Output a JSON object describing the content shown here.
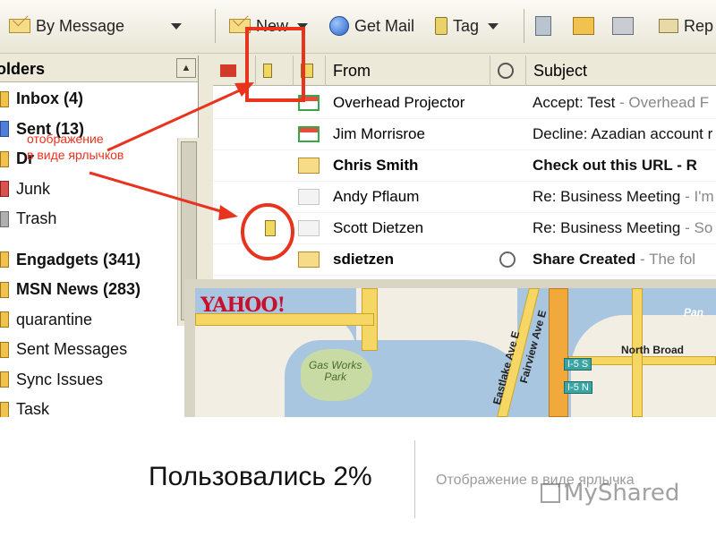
{
  "toolbar": {
    "view_label": "By Message",
    "new_label": "New",
    "get_mail_label": "Get Mail",
    "tag_label": "Tag",
    "reply_label": "Rep"
  },
  "folders": {
    "header": "olders",
    "items": [
      {
        "label": "Inbox (4)",
        "bold": true
      },
      {
        "label": "Sent (13)",
        "bold": true
      },
      {
        "label": "Dr",
        "bold": true
      },
      {
        "label": "Junk",
        "bold": false
      },
      {
        "label": "Trash",
        "bold": false
      },
      {
        "label": "Engadgets (341)",
        "bold": true
      },
      {
        "label": "MSN News (283)",
        "bold": true
      },
      {
        "label": "quarantine",
        "bold": false
      },
      {
        "label": "Sent Messages",
        "bold": false
      },
      {
        "label": "Sync Issues",
        "bold": false
      },
      {
        "label": "Task",
        "bold": false
      }
    ]
  },
  "message_list": {
    "columns": {
      "from": "From",
      "subject": "Subject"
    },
    "rows": [
      {
        "from": "Overhead Projector",
        "subject": "Accept: Test",
        "preview": " - Overhead F",
        "bold": false,
        "icon": "calendar-icon"
      },
      {
        "from": "Jim Morrisroe",
        "subject": "Decline: Azadian account r",
        "preview": "",
        "bold": false,
        "icon": "calendar-icon"
      },
      {
        "from": "Chris Smith",
        "subject": "Check out this URL - R",
        "preview": "",
        "bold": true,
        "icon": "envelope-icon"
      },
      {
        "from": "Andy Pflaum",
        "subject": "Re: Business Meeting",
        "preview": " - I'm",
        "bold": false,
        "icon": "open-envelope-icon"
      },
      {
        "from": "Scott Dietzen",
        "subject": "Re: Business Meeting",
        "preview": " - So",
        "bold": false,
        "icon": "open-envelope-icon"
      },
      {
        "from": "sdietzen",
        "subject": "Share Created",
        "preview": " - The fol",
        "bold": true,
        "icon": "envelope-icon"
      }
    ]
  },
  "map": {
    "logo": "YAHOO!",
    "park_line1": "Gas Works",
    "park_line2": "Park",
    "street_1": "Eastlake Ave E",
    "street_2": "Fairview Ave E",
    "north_broadway": "North Broad",
    "shield_1": "I-5 S",
    "shield_2": "I-5 N",
    "corner": "Pan"
  },
  "annotation": {
    "line1": "отображение",
    "line2": "в виде ярлычков"
  },
  "caption": {
    "main": "Пользовались 2%",
    "sub": "Отображение в виде ярлычка",
    "watermark": "MyShared"
  },
  "colors": {
    "annotation_red": "#e8331e",
    "toolbar_bg": "#ece9d8"
  }
}
